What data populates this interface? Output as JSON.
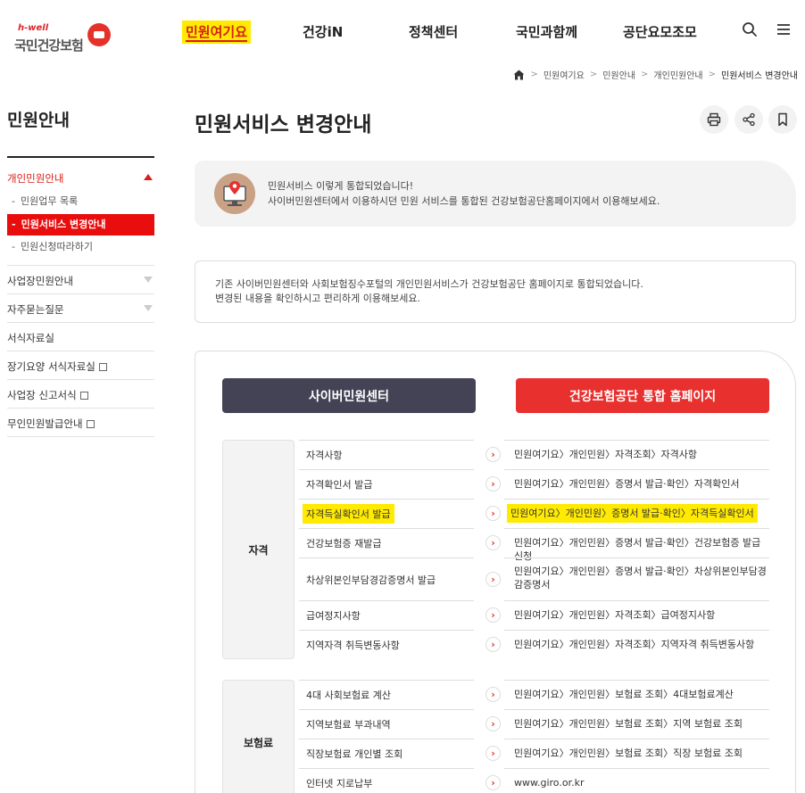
{
  "header": {
    "logo_tag": "h-well",
    "logo_text": "국민건강보험",
    "nav": [
      "민원여기요",
      "건강iN",
      "정책센터",
      "국민과함께",
      "공단요모조모"
    ],
    "icons": [
      "search-icon",
      "menu-icon"
    ]
  },
  "breadcrumb": [
    "민원여기요",
    "민원안내",
    "개인민원안내",
    "민원서비스 변경안내"
  ],
  "sidebar": {
    "title": "민원안내",
    "items": [
      {
        "label": "개인민원안내",
        "sub": [
          "민원업무 목록",
          "민원서비스 변경안내",
          "민원신청따라하기"
        ]
      },
      {
        "label": "사업장민원안내"
      },
      {
        "label": "자주묻는질문"
      },
      {
        "label": "서식자료실"
      },
      {
        "label": "장기요양 서식자료실"
      },
      {
        "label": "사업장 신고서식"
      },
      {
        "label": "무인민원발급안내"
      }
    ]
  },
  "main": {
    "title": "민원서비스 변경안내",
    "tools": [
      "print-icon",
      "share-icon",
      "bookmark-icon"
    ],
    "notice": {
      "line1": "민원서비스 이렇게 통합되었습니다!",
      "line2": "사이버민원센터에서 이용하시던 민원 서비스를 통합된 건강보험공단홈페이지에서 이용해보세요."
    },
    "info": {
      "line1": "기존 사이버민원센터와 사회보험징수포털의 개인민원서비스가 건강보험공단 홈페이지로 통합되었습니다.",
      "line2": "변경된 내용을 확인하시고 편리하게 이용해보세요."
    },
    "buttons": {
      "cyber": "사이버민원센터",
      "home": "건강보험공단 통합 홈페이지"
    },
    "categories": [
      {
        "name": "자격",
        "rows": [
          {
            "name": "자격사항",
            "path": "민원여기요〉개인민원〉자격조회〉자격사항"
          },
          {
            "name": "자격확인서 발급",
            "path": "민원여기요〉개인민원〉증명서 발급·확인〉자격확인서"
          },
          {
            "name": "자격득실확인서 발급",
            "path": "민원여기요〉개인민원〉증명서 발급·확인〉자격득실확인서"
          },
          {
            "name": "건강보험증 재발급",
            "path": "민원여기요〉개인민원〉증명서 발급·확인〉건강보험증 발급 신청"
          },
          {
            "name": "차상위본인부담경감증명서 발급",
            "path": "민원여기요〉개인민원〉증명서 발급·확인〉차상위본인부담경감증명서"
          },
          {
            "name": "급여정지사항",
            "path": "민원여기요〉개인민원〉자격조회〉급여정지사항"
          },
          {
            "name": "지역자격 취득변동사항",
            "path": "민원여기요〉개인민원〉자격조회〉지역자격 취득변동사항"
          }
        ]
      },
      {
        "name": "보험료",
        "rows": [
          {
            "name": "4대 사회보험료 계산",
            "path": "민원여기요〉개인민원〉보험료 조회〉4대보험료계산"
          },
          {
            "name": "지역보험료 부과내역",
            "path": "민원여기요〉개인민원〉보험료 조회〉지역 보험료 조회"
          },
          {
            "name": "직장보험료 개인별 조회",
            "path": "민원여기요〉개인민원〉보험료 조회〉직장 보험료 조회"
          },
          {
            "name": "인터넷 지로납부",
            "path": "www.giro.or.kr"
          }
        ]
      }
    ],
    "arrow_glyph": "›"
  },
  "colors": {
    "brand_red": "#e8302e",
    "dark_button": "#434355",
    "highlight": "#ffea00",
    "sidebar_active": "#ea0d0d"
  }
}
